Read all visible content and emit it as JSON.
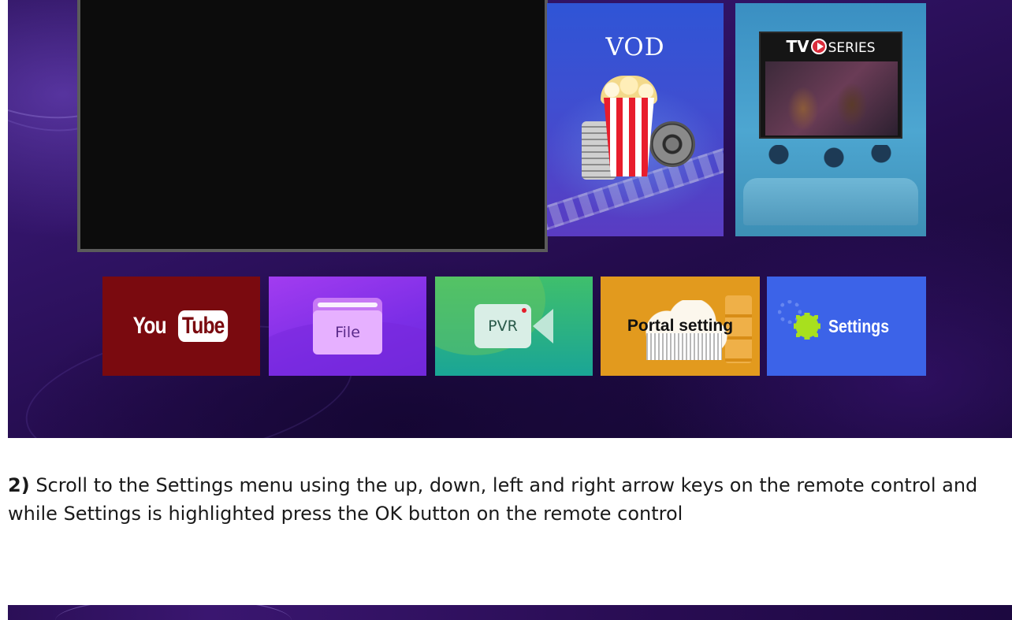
{
  "home_screen": {
    "tiles": {
      "vod": {
        "title": "VOD"
      },
      "series": {
        "logo_tv": "TV",
        "logo_series": "SERIES"
      },
      "youtube": {
        "you": "You",
        "tube": "Tube"
      },
      "file": {
        "label": "File"
      },
      "pvr": {
        "label": "PVR"
      },
      "portal": {
        "label": "Portal setting"
      },
      "settings": {
        "label": "Settings"
      }
    },
    "colors": {
      "youtube_bg": "#7a0a0f",
      "file_bg": "#8a32ea",
      "pvr_bg": "#2ab38a",
      "portal_bg": "#e29a1e",
      "settings_bg": "#3c63e8",
      "settings_gear": "#a8e01e"
    }
  },
  "instruction": {
    "step_number": "2)",
    "text": "Scroll to the Settings menu using the up, down, left and right arrow keys on the remote control and while Settings is highlighted press the OK button on the remote control"
  }
}
